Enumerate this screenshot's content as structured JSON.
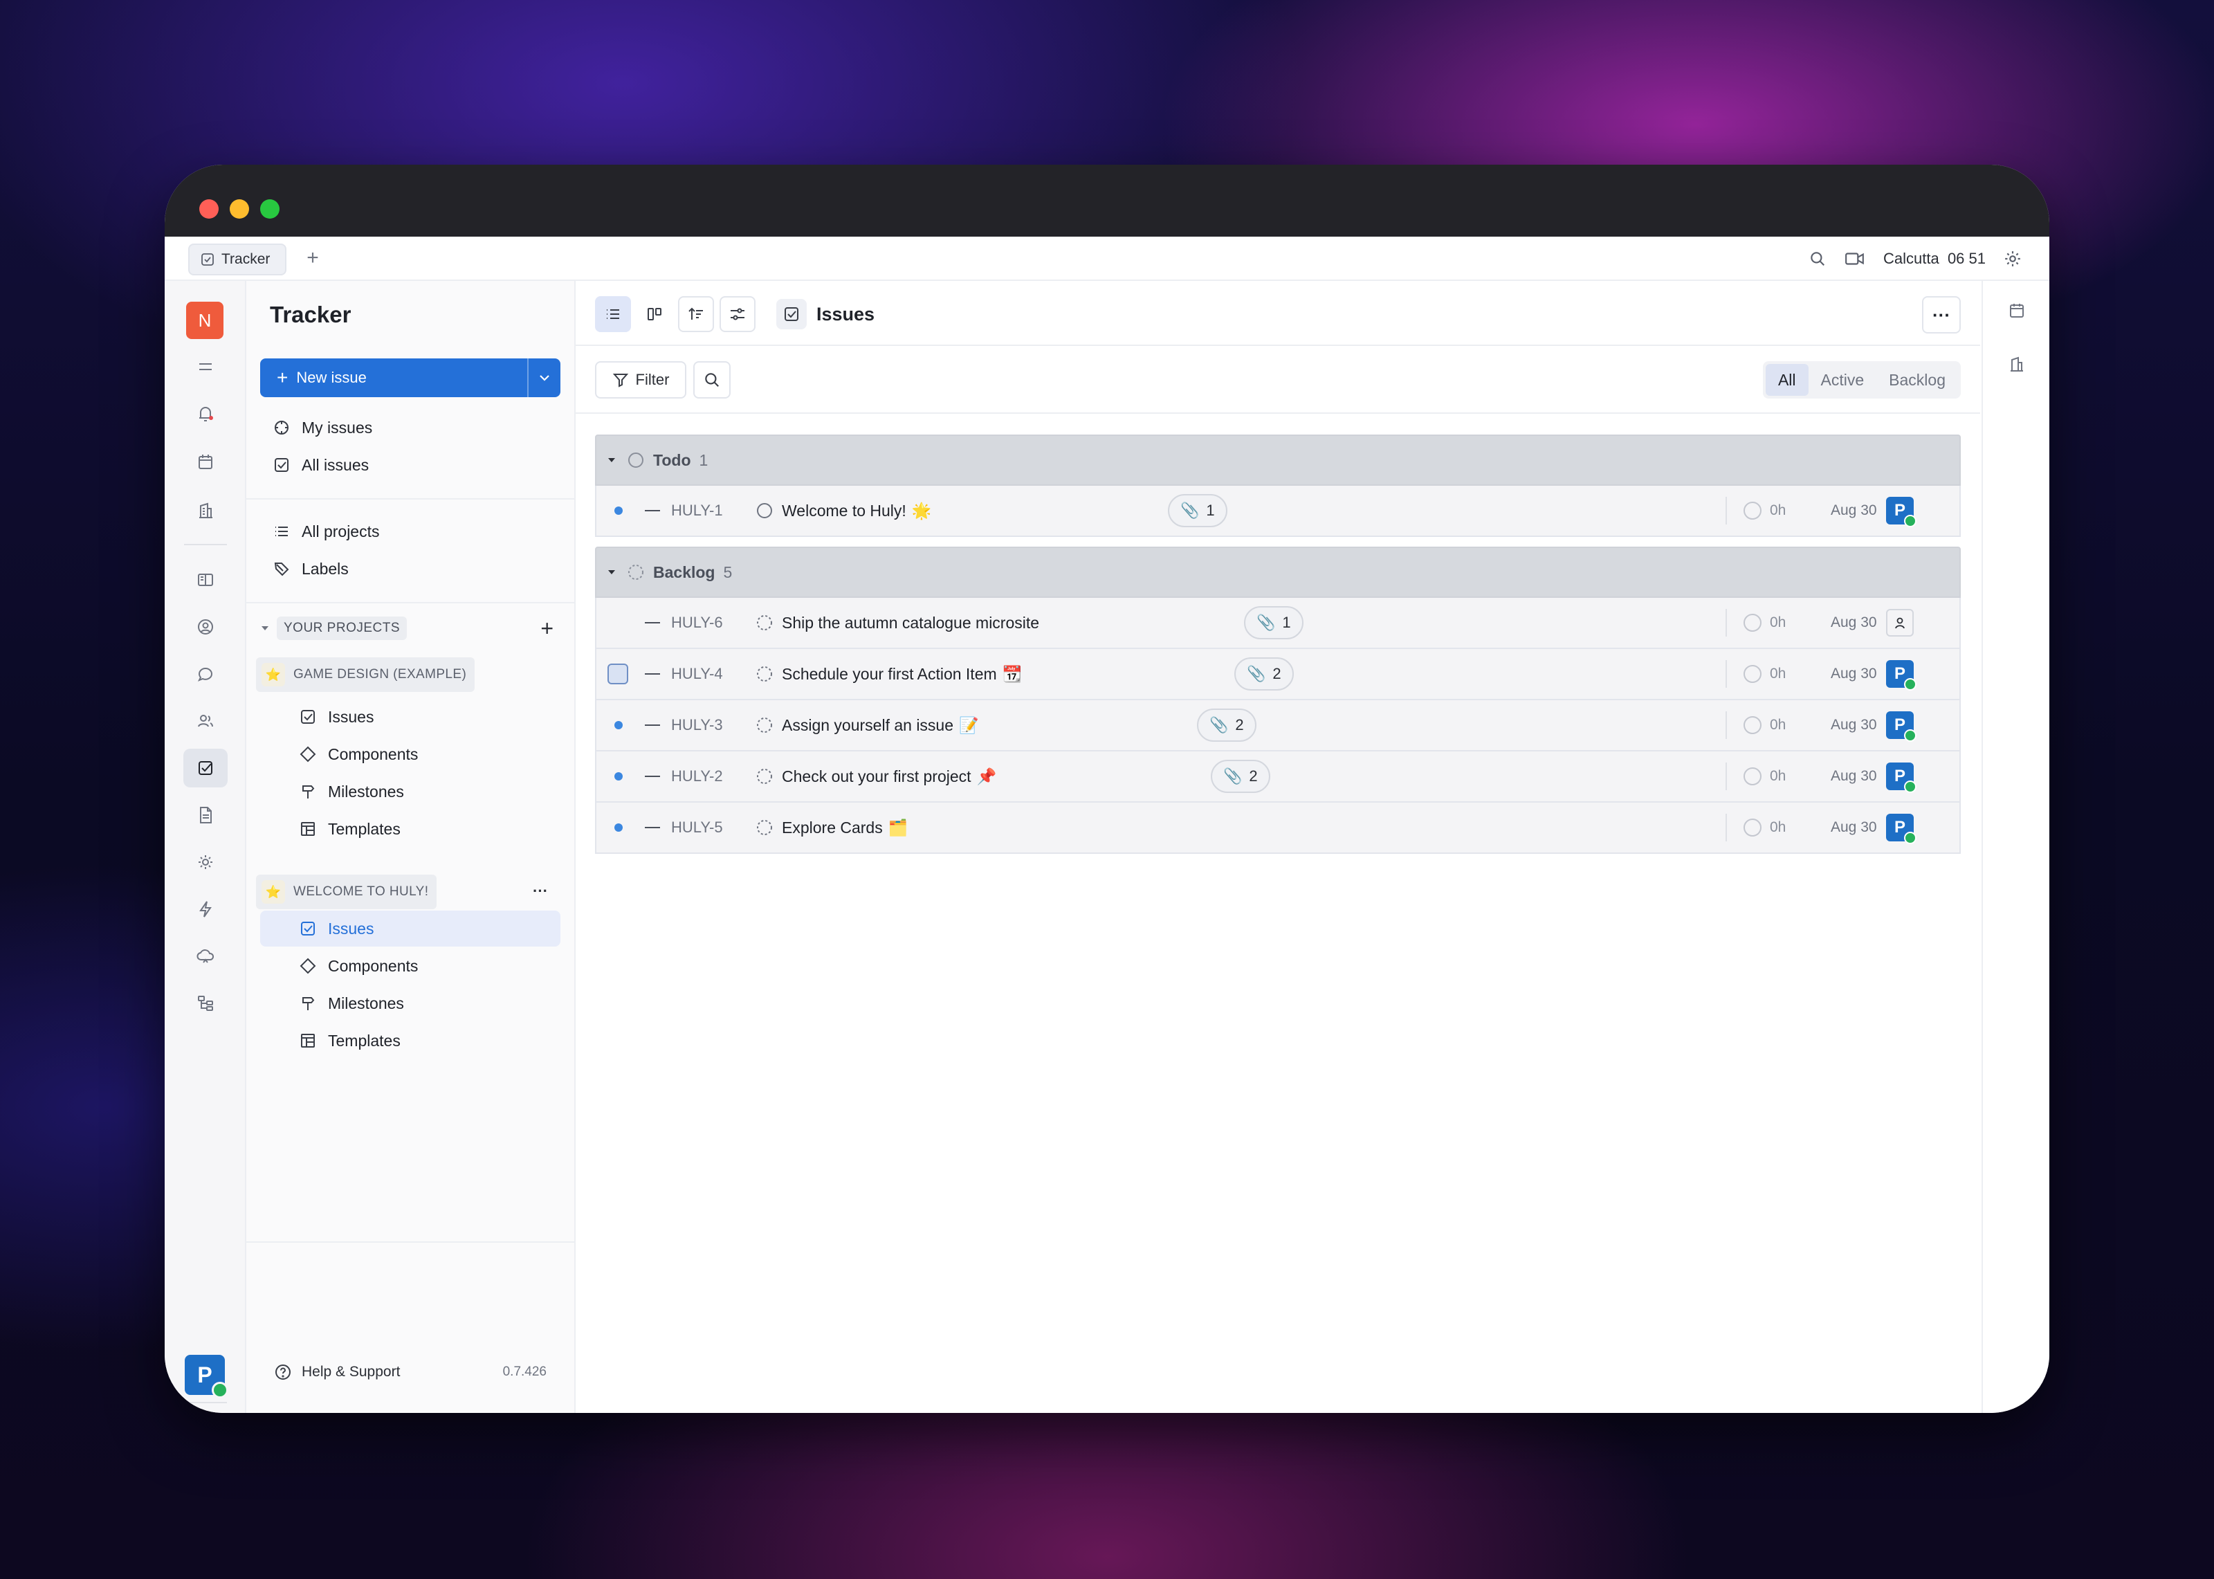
{
  "window": {
    "traffic_lights": [
      "#ff5f57",
      "#febc2e",
      "#28c840"
    ]
  },
  "tabs": [
    {
      "label": "Tracker"
    }
  ],
  "topbar": {
    "location": "Calcutta",
    "time": "06 51"
  },
  "workspace": {
    "initial": "N",
    "color": "#ef5b3c"
  },
  "user": {
    "initial": "P",
    "color": "#1e6fc6"
  },
  "nav": {
    "title": "Tracker",
    "new_issue_label": "New issue",
    "my_issues": "My issues",
    "all_issues": "All issues",
    "all_projects": "All projects",
    "labels": "Labels",
    "your_projects": "YOUR PROJECTS",
    "projects": [
      {
        "name": "GAME DESIGN (EXAMPLE)",
        "items": [
          "Issues",
          "Components",
          "Milestones",
          "Templates"
        ]
      },
      {
        "name": "WELCOME TO HULY!",
        "items": [
          "Issues",
          "Components",
          "Milestones",
          "Templates"
        ]
      }
    ],
    "help_label": "Help & Support",
    "version": "0.7.426"
  },
  "main": {
    "breadcrumb": "Issues",
    "more": "···",
    "filter_label": "Filter",
    "modes": [
      "All",
      "Active",
      "Backlog"
    ],
    "selected_mode": "All",
    "groups": [
      {
        "name": "Todo",
        "count": "1",
        "issues": [
          {
            "id": "HULY-1",
            "title": "Welcome to Huly!",
            "emoji": "🌟",
            "attachments": "1",
            "estimate": "0h",
            "date": "Aug 30",
            "assignee": "P"
          }
        ]
      },
      {
        "name": "Backlog",
        "count": "5",
        "issues": [
          {
            "id": "HULY-6",
            "title": "Ship the autumn catalogue microsite",
            "emoji": "",
            "attachments": "1",
            "estimate": "0h",
            "date": "Aug 30",
            "assignee": ""
          },
          {
            "id": "HULY-4",
            "title": "Schedule your first Action Item",
            "emoji": "📆",
            "attachments": "2",
            "estimate": "0h",
            "date": "Aug 30",
            "assignee": "P"
          },
          {
            "id": "HULY-3",
            "title": "Assign yourself an issue",
            "emoji": "📝",
            "attachments": "2",
            "estimate": "0h",
            "date": "Aug 30",
            "assignee": "P"
          },
          {
            "id": "HULY-2",
            "title": "Check out your first project",
            "emoji": "📌",
            "attachments": "2",
            "estimate": "0h",
            "date": "Aug 30",
            "assignee": "P"
          },
          {
            "id": "HULY-5",
            "title": "Explore Cards",
            "emoji": "🗂️",
            "attachments": "",
            "estimate": "0h",
            "date": "Aug 30",
            "assignee": "P"
          }
        ]
      }
    ]
  }
}
